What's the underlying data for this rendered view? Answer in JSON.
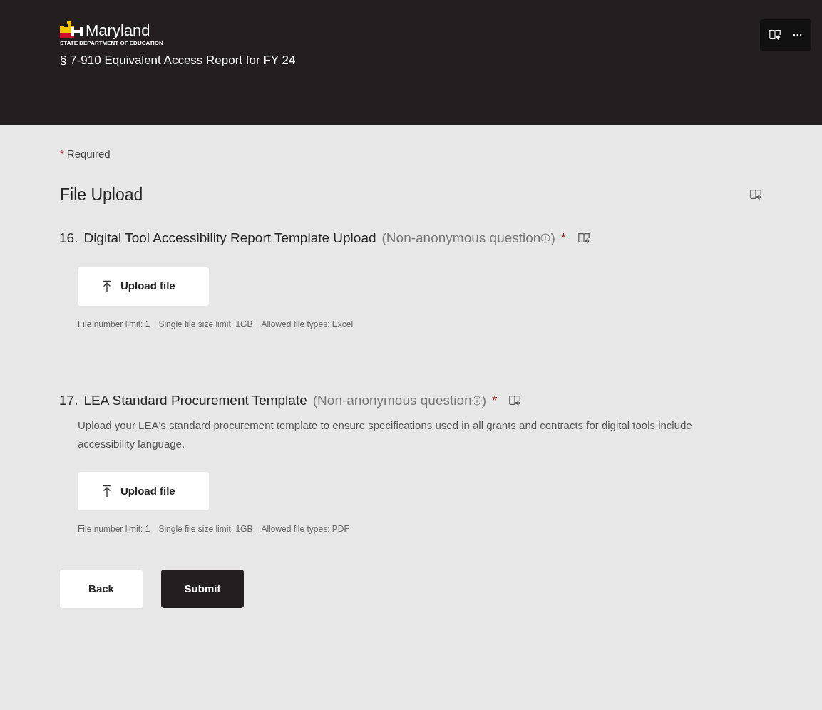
{
  "header": {
    "logo_name": "Maryland",
    "logo_subtitle": "STATE DEPARTMENT OF EDUCATION",
    "form_title": "§ 7-910 Equivalent Access Report for FY 24",
    "more_button": "···"
  },
  "required_note": {
    "mark": "*",
    "label": "Required"
  },
  "section_title": "File Upload",
  "questions": [
    {
      "number": "16.",
      "title": "Digital Tool Accessibility Report Template Upload",
      "note_open": "(Non-anonymous question",
      "note_close": ")",
      "required_mark": "*",
      "button": "Upload file",
      "limits": [
        "File number limit: 1",
        "Single file size limit: 1GB",
        "Allowed file types: Excel"
      ]
    },
    {
      "number": "17.",
      "title": "LEA Standard Procurement Template",
      "note_open": "(Non-anonymous question",
      "note_close": ")",
      "required_mark": "*",
      "description": "Upload your LEA's standard procurement template to ensure specifications used in all grants and contracts for digital tools include accessibility language.",
      "button": "Upload file",
      "limits": [
        "File number limit: 1",
        "Single file size limit: 1GB",
        "Allowed file types: PDF"
      ]
    }
  ],
  "buttons": [
    {
      "label": "Back",
      "kind": "secondary"
    },
    {
      "label": "Submit",
      "kind": "primary"
    }
  ]
}
